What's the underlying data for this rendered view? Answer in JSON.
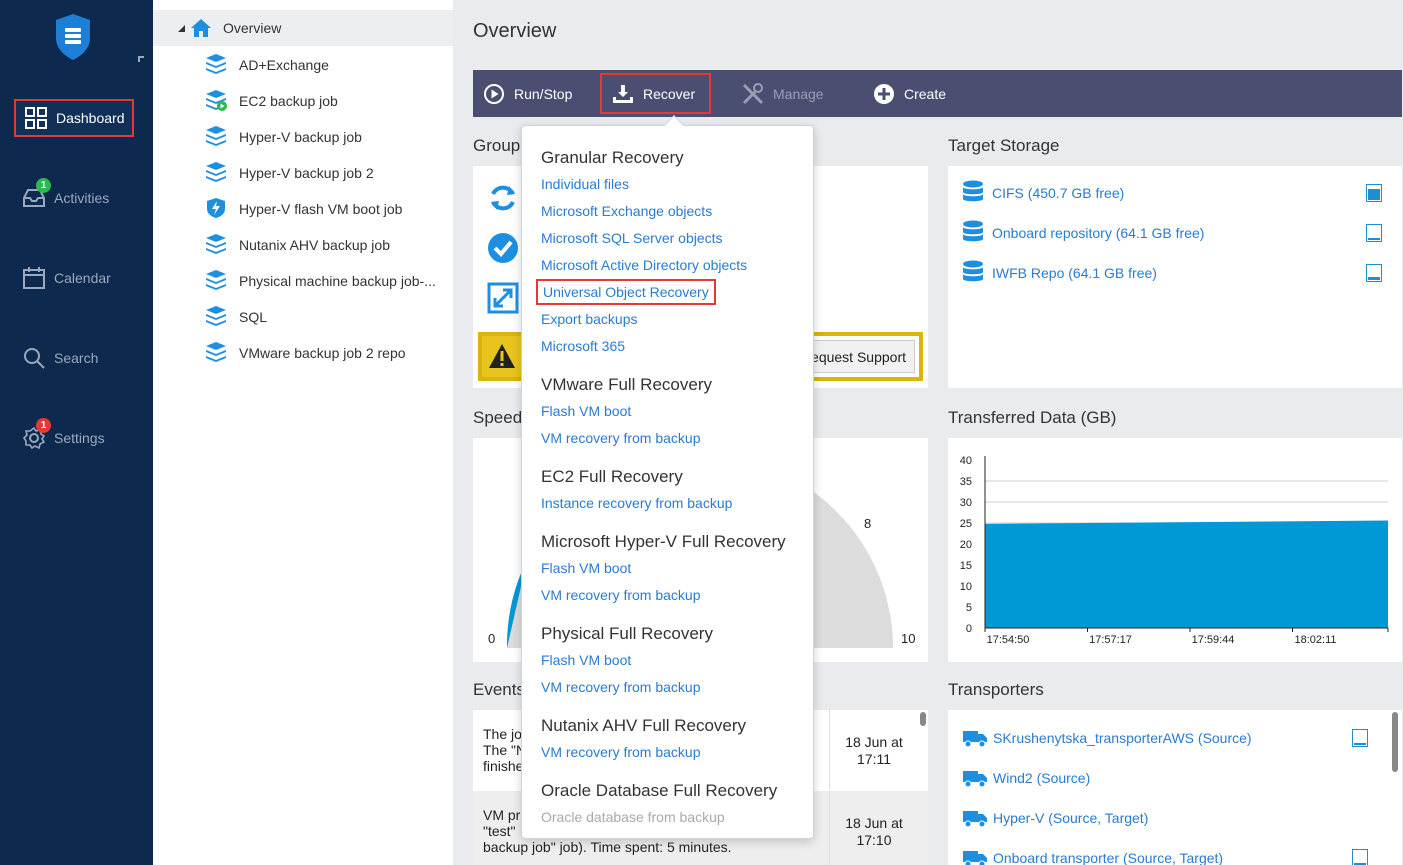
{
  "nav": {
    "items": [
      {
        "label": "Dashboard",
        "icon": "dashboard-grid-icon",
        "active": true
      },
      {
        "label": "Activities",
        "icon": "inbox-icon",
        "badge": "1",
        "badge_color": "#2db84d"
      },
      {
        "label": "Calendar",
        "icon": "calendar-icon"
      },
      {
        "label": "Search",
        "icon": "search-icon"
      },
      {
        "label": "Settings",
        "icon": "gear-icon",
        "badge": "1",
        "badge_color": "#e53935"
      }
    ]
  },
  "tree": {
    "root": "Overview",
    "items": [
      "AD+Exchange",
      "EC2 backup job",
      "Hyper-V backup job",
      "Hyper-V backup job 2",
      "Hyper-V flash VM boot job",
      "Nutanix AHV backup job",
      "Physical machine backup job-...",
      "SQL",
      "VMware backup job 2 repo"
    ]
  },
  "main": {
    "title": "Overview",
    "toolbar": {
      "run_stop": "Run/Stop",
      "recover": "Recover",
      "manage": "Manage",
      "create": "Create"
    },
    "group_title": "Group",
    "request_support": "equest Support",
    "speed_title": "Speed",
    "speed_ticks": {
      "min": "0",
      "eight": "8",
      "max": "10"
    },
    "events_title": "Events",
    "events": [
      {
        "text_lines": [
          "The jo",
          "The \"N",
          "finishe"
        ],
        "date": "18 Jun at",
        "time": "17:11"
      },
      {
        "text_lines": [
          "VM pr",
          "\"test\"",
          "backup job\" job). Time spent: 5 minutes."
        ],
        "date": "18 Jun at",
        "time": "17:10"
      }
    ]
  },
  "storage": {
    "title": "Target Storage",
    "items": [
      {
        "label": "CIFS (450.7 GB free)",
        "fill": 0.75
      },
      {
        "label": "Onboard repository (64.1 GB free)",
        "fill": 0.1
      },
      {
        "label": "IWFB Repo (64.1 GB free)",
        "fill": 0.2
      }
    ]
  },
  "transfer": {
    "title": "Transferred Data (GB)"
  },
  "chart_data": {
    "type": "area",
    "title": "Transferred Data (GB)",
    "x": [
      "17:54:50",
      "17:57:17",
      "17:59:44",
      "18:02:11"
    ],
    "y_ticks": [
      0,
      5,
      10,
      15,
      20,
      25,
      30,
      35,
      40
    ],
    "ylim": [
      0,
      40
    ],
    "series": [
      {
        "start": 24.8,
        "end": 25.6
      }
    ],
    "color": "#0099d6",
    "grid": true
  },
  "transporters": {
    "title": "Transporters",
    "items": [
      {
        "label": "SKrushenytska_transporterAWS (Source)"
      },
      {
        "label": "Wind2 (Source)"
      },
      {
        "label": "Hyper-V (Source, Target)"
      },
      {
        "label": "Onboard transporter (Source, Target)"
      }
    ]
  },
  "recover_menu": {
    "sections": [
      {
        "heading": "Granular Recovery",
        "items": [
          {
            "label": "Individual files"
          },
          {
            "label": "Microsoft Exchange objects"
          },
          {
            "label": "Microsoft SQL Server objects"
          },
          {
            "label": "Microsoft Active Directory objects"
          },
          {
            "label": "Universal Object Recovery",
            "highlight": true
          },
          {
            "label": "Export backups"
          },
          {
            "label": "Microsoft 365"
          }
        ]
      },
      {
        "heading": "VMware Full Recovery",
        "items": [
          {
            "label": "Flash VM boot"
          },
          {
            "label": "VM recovery from backup"
          }
        ]
      },
      {
        "heading": "EC2 Full Recovery",
        "items": [
          {
            "label": "Instance recovery from backup"
          }
        ]
      },
      {
        "heading": "Microsoft Hyper-V Full Recovery",
        "items": [
          {
            "label": "Flash VM boot"
          },
          {
            "label": "VM recovery from backup"
          }
        ]
      },
      {
        "heading": "Physical Full Recovery",
        "items": [
          {
            "label": "Flash VM boot"
          },
          {
            "label": "VM recovery from backup"
          }
        ]
      },
      {
        "heading": "Nutanix AHV Full Recovery",
        "items": [
          {
            "label": "VM recovery from backup"
          }
        ]
      },
      {
        "heading": "Oracle Database Full Recovery",
        "items": [
          {
            "label": "Oracle database from backup",
            "disabled": true
          }
        ]
      }
    ]
  },
  "colors": {
    "rail": "#0d2a4e",
    "toolbar": "#4a4f72",
    "link": "#2a7bd1",
    "accent_blue": "#1d8fd1",
    "highlight_red": "#e53935"
  }
}
